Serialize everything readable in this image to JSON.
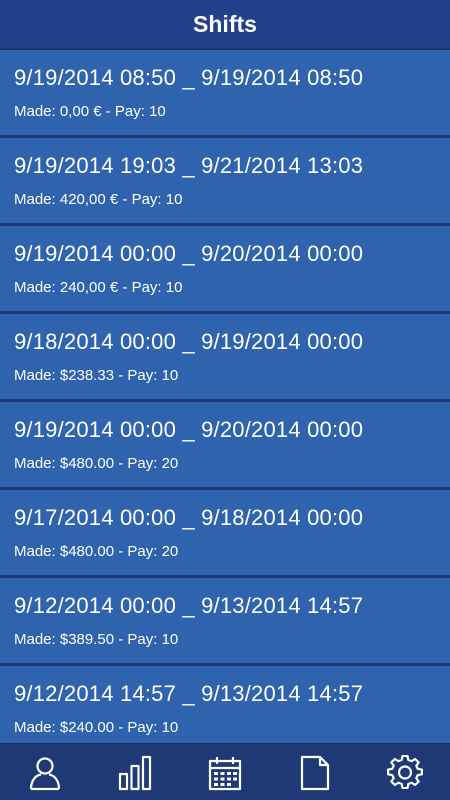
{
  "header": {
    "title": "Shifts"
  },
  "shifts": [
    {
      "range": "9/19/2014 08:50 _ 9/19/2014 08:50",
      "made": "Made: 0,00 € - Pay: 10"
    },
    {
      "range": "9/19/2014 19:03 _ 9/21/2014 13:03",
      "made": "Made: 420,00 € - Pay: 10"
    },
    {
      "range": "9/19/2014 00:00 _ 9/20/2014 00:00",
      "made": "Made: 240,00 € - Pay: 10"
    },
    {
      "range": "9/18/2014 00:00 _ 9/19/2014 00:00",
      "made": "Made: $238.33 - Pay: 10"
    },
    {
      "range": "9/19/2014 00:00 _ 9/20/2014 00:00",
      "made": "Made: $480.00 - Pay: 20"
    },
    {
      "range": "9/17/2014 00:00 _ 9/18/2014 00:00",
      "made": "Made: $480.00 - Pay: 20"
    },
    {
      "range": "9/12/2014 00:00 _ 9/13/2014 14:57",
      "made": "Made: $389.50 - Pay: 10"
    },
    {
      "range": "9/12/2014 14:57 _ 9/13/2014 14:57",
      "made": "Made: $240.00 - Pay: 10"
    }
  ],
  "tabbar": {
    "items": [
      {
        "icon": "user-icon"
      },
      {
        "icon": "bar-chart-icon"
      },
      {
        "icon": "calendar-icon"
      },
      {
        "icon": "document-icon"
      },
      {
        "icon": "gear-icon"
      }
    ]
  },
  "colors": {
    "header_bg": "#23418a",
    "row_bg": "#2f63ad",
    "separator": "#1f3a78",
    "tabbar_bg": "#1e3975",
    "text": "#ffffff"
  }
}
